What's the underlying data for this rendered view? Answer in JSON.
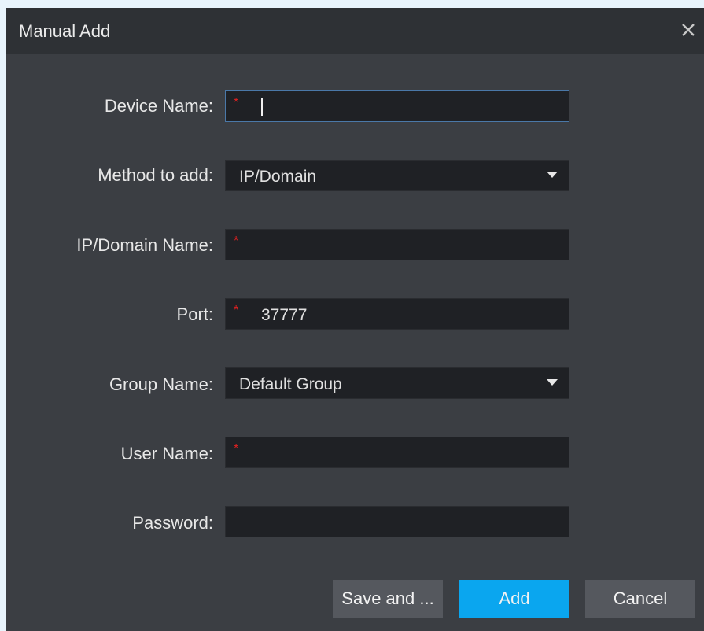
{
  "dialog": {
    "title": "Manual Add",
    "close_icon": "close-icon"
  },
  "form": {
    "device_name": {
      "label": "Device Name:",
      "required_mark": "*",
      "value": ""
    },
    "method_to_add": {
      "label": "Method to add:",
      "selected": "IP/Domain"
    },
    "ip_domain_name": {
      "label": "IP/Domain Name:",
      "required_mark": "*",
      "value": ""
    },
    "port": {
      "label": "Port:",
      "required_mark": "*",
      "value": "37777"
    },
    "group_name": {
      "label": "Group Name:",
      "selected": "Default Group"
    },
    "user_name": {
      "label": "User Name:",
      "required_mark": "*",
      "value": ""
    },
    "password": {
      "label": "Password:",
      "value": ""
    }
  },
  "buttons": {
    "save_and": "Save and ...",
    "add": "Add",
    "cancel": "Cancel"
  },
  "colors": {
    "dialog_bg": "#3b3e43",
    "titlebar_bg": "#2e3135",
    "field_bg": "#1f2125",
    "required": "#e02020",
    "primary": "#0aa6ef",
    "secondary": "#55585e",
    "focus_border": "#4a78a8"
  }
}
